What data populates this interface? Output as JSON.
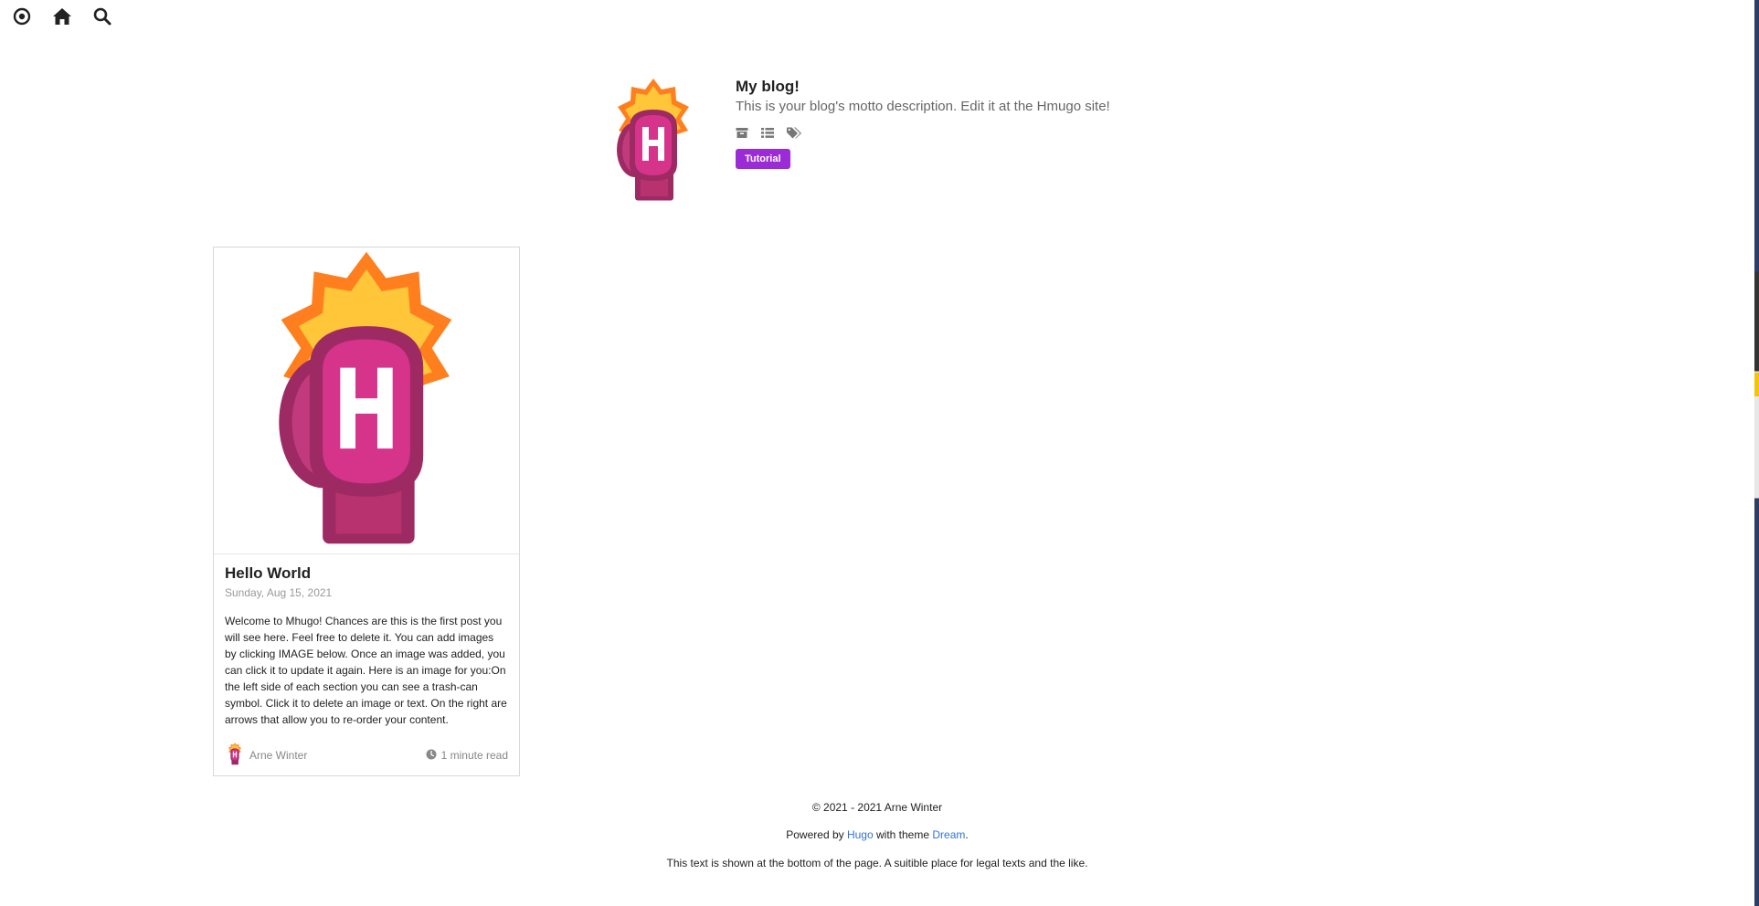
{
  "nav": {
    "icons": [
      "dream-circle-icon",
      "home-icon",
      "search-icon"
    ]
  },
  "header": {
    "title": "My blog!",
    "motto": "This is your blog's motto description. Edit it at the Hmugo site!",
    "icons": [
      "archive-icon",
      "list-icon",
      "tags-icon"
    ],
    "tag": "Tutorial"
  },
  "post": {
    "title": "Hello World",
    "date": "Sunday, Aug 15, 2021",
    "excerpt": "Welcome to Mhugo! Chances are this is the first post you will see here. Feel free to delete it. You can add images by clicking IMAGE below. Once an image was added, you can click it to update it again. Here is an image for you:On the left side of each section you can see a trash-can symbol. Click it to delete an image or text. On the right are arrows that allow you to re-order your content.",
    "author": "Arne Winter",
    "read_time": "1 minute read"
  },
  "footer": {
    "copyright": "© 2021 - 2021 Arne Winter",
    "powered_prefix": "Powered by",
    "hugo_link": "Hugo",
    "powered_middle": "with theme",
    "theme_link": "Dream",
    "powered_suffix": ".",
    "legal": "This text is shown at the bottom of the page. A suitible place for legal texts and the like."
  },
  "colors": {
    "accent": "#9b2bd6",
    "link": "#3273dc",
    "glove": "#d6338a"
  }
}
